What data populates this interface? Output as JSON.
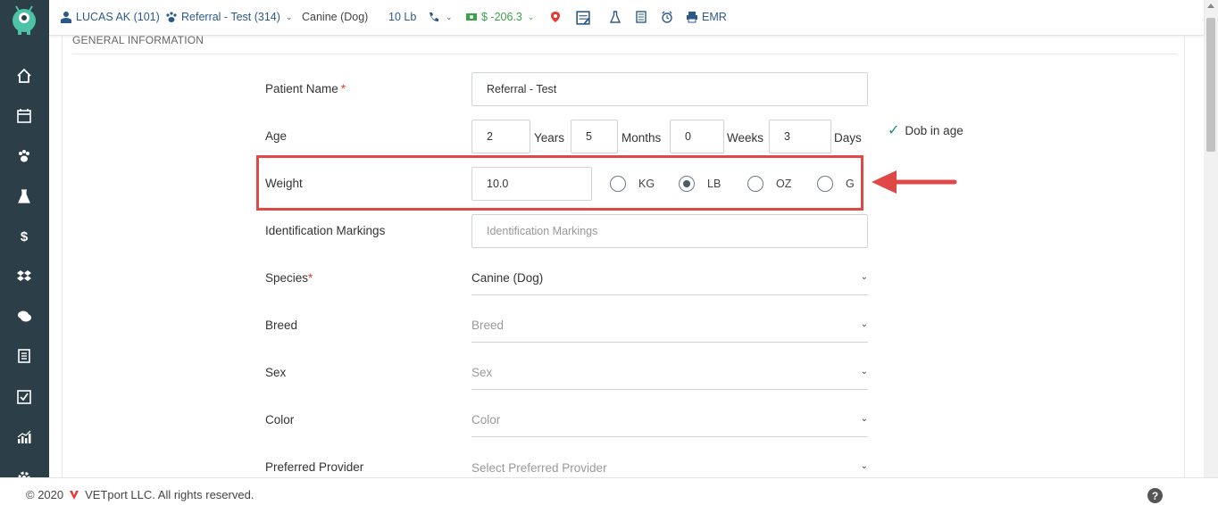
{
  "topbar": {
    "owner": "LUCAS AK (101)",
    "patient": "Referral - Test (314)",
    "species": "Canine (Dog)",
    "weight": "10 Lb",
    "balance": "$ -206.3",
    "emr": "EMR"
  },
  "form": {
    "section_title": "GENERAL INFORMATION",
    "patient_name": {
      "label": "Patient Name",
      "required": "*",
      "value": "Referral - Test"
    },
    "age": {
      "label": "Age",
      "years_value": "2",
      "years_label": "Years",
      "months_value": "5",
      "months_label": "Months",
      "weeks_value": "0",
      "weeks_label": "Weeks",
      "days_value": "3",
      "days_label": "Days",
      "dob_in_age": "Dob in age"
    },
    "weight": {
      "label": "Weight",
      "value": "10.0",
      "units": [
        "KG",
        "LB",
        "OZ",
        "G"
      ],
      "selected_unit": "LB"
    },
    "identification": {
      "label": "Identification Markings",
      "placeholder": "Identification Markings"
    },
    "species": {
      "label": "Species",
      "required": "*",
      "value": "Canine (Dog)"
    },
    "breed": {
      "label": "Breed",
      "placeholder": "Breed"
    },
    "sex": {
      "label": "Sex",
      "placeholder": "Sex"
    },
    "color": {
      "label": "Color",
      "placeholder": "Color"
    },
    "provider": {
      "label": "Preferred Provider",
      "placeholder": "Select Preferred Provider"
    }
  },
  "footer": {
    "copyright": "© 2020",
    "company": "VETport LLC. All rights reserved.",
    "help": "?"
  },
  "colors": {
    "sidebar": "#2c3e48",
    "accent_link": "#2b5a8a",
    "balance_green": "#3aa24a",
    "highlight_red": "#e04848"
  }
}
